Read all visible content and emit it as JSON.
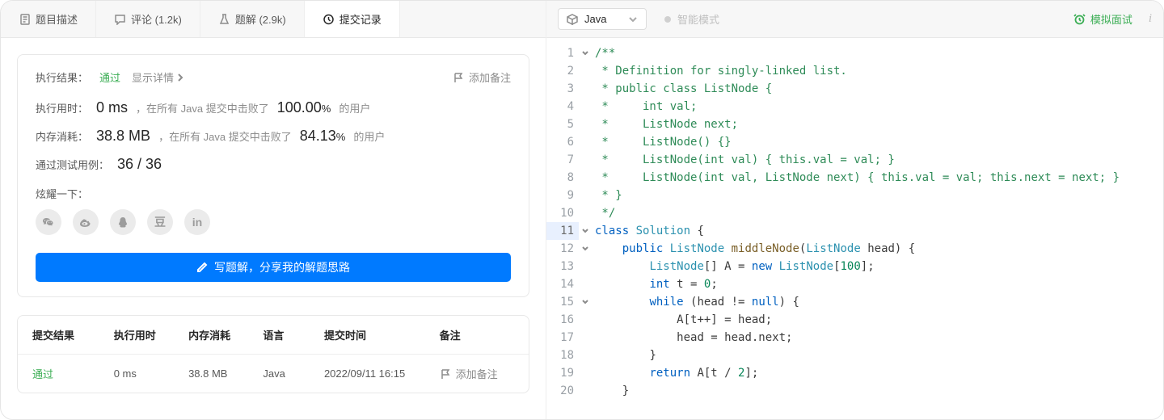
{
  "tabs": {
    "description": "题目描述",
    "comments": "评论 (1.2k)",
    "solutions": "题解 (2.9k)",
    "submissions": "提交记录"
  },
  "result": {
    "label": "执行结果：",
    "status": "通过",
    "show_details": "显示详情",
    "add_note": "添加备注",
    "runtime_label": "执行用时：",
    "runtime_value": "0 ms",
    "runtime_text1": "，在所有 Java 提交中击败了",
    "runtime_pct": "100.00",
    "pct_sign": "%",
    "of_users": " 的用户",
    "memory_label": "内存消耗：",
    "memory_value": "38.8 MB",
    "memory_text1": "，在所有 Java 提交中击败了",
    "memory_pct": "84.13",
    "tests_label": "通过测试用例：",
    "tests_value": "36 / 36",
    "share_label": "炫耀一下：",
    "write_btn": "写题解，分享我的解题思路"
  },
  "share_icons": [
    "wechat",
    "weibo",
    "qq",
    "douban",
    "linkedin"
  ],
  "table": {
    "headers": {
      "result": "提交结果",
      "runtime": "执行用时",
      "memory": "内存消耗",
      "lang": "语言",
      "time": "提交时间",
      "note": "备注"
    },
    "row": {
      "result": "通过",
      "runtime": "0 ms",
      "memory": "38.8 MB",
      "lang": "Java",
      "time": "2022/09/11 16:15",
      "note": "添加备注"
    }
  },
  "editor": {
    "lang": "Java",
    "smart_mode": "智能模式",
    "mock_interview": "模拟面试",
    "lines": [
      "/**",
      " * Definition for singly-linked list.",
      " * public class ListNode {",
      " *     int val;",
      " *     ListNode next;",
      " *     ListNode() {}",
      " *     ListNode(int val) { this.val = val; }",
      " *     ListNode(int val, ListNode next) { this.val = val; this.next = next; }",
      " * }",
      " */",
      "class Solution {",
      "    public ListNode middleNode(ListNode head) {",
      "        ListNode[] A = new ListNode[100];",
      "        int t = 0;",
      "        while (head != null) {",
      "            A[t++] = head;",
      "            head = head.next;",
      "        }",
      "        return A[t / 2];",
      "    }"
    ],
    "fold_lines": [
      1,
      11,
      12,
      15
    ],
    "highlight_line": 11,
    "line_count": 20
  }
}
